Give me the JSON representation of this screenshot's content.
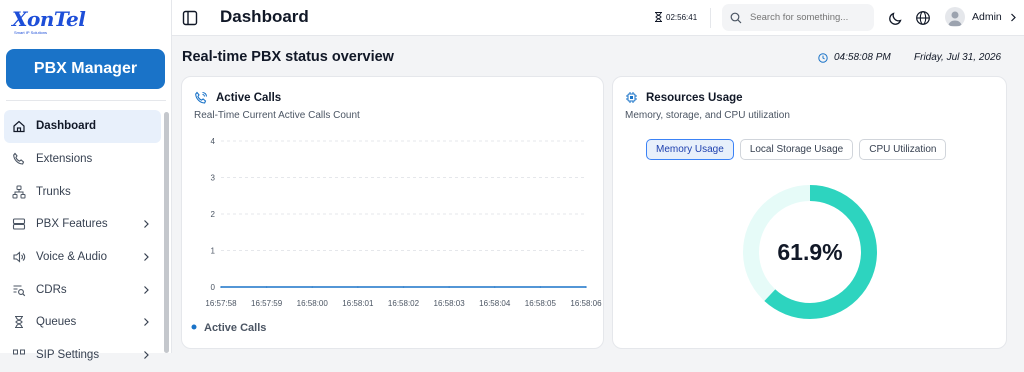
{
  "brand": {
    "logo_text": "XonTel",
    "tagline": "Smart IP Solutions"
  },
  "sidebar": {
    "pbx_button": "PBX Manager",
    "items": [
      {
        "label": "Dashboard",
        "icon": "home-icon",
        "active": true,
        "chevron": false
      },
      {
        "label": "Extensions",
        "icon": "phone-icon",
        "active": false,
        "chevron": false
      },
      {
        "label": "Trunks",
        "icon": "network-icon",
        "active": false,
        "chevron": false
      },
      {
        "label": "PBX Features",
        "icon": "server-icon",
        "active": false,
        "chevron": true
      },
      {
        "label": "Voice & Audio",
        "icon": "speaker-icon",
        "active": false,
        "chevron": true
      },
      {
        "label": "CDRs",
        "icon": "list-search-icon",
        "active": false,
        "chevron": true
      },
      {
        "label": "Queues",
        "icon": "hourglass-icon",
        "active": false,
        "chevron": true
      },
      {
        "label": "SIP Settings",
        "icon": "sip-icon",
        "active": false,
        "chevron": true
      }
    ]
  },
  "topbar": {
    "title": "Dashboard",
    "timer": "02:56:41",
    "search_placeholder": "Search for something...",
    "user": "Admin"
  },
  "content": {
    "page_title": "Real-time PBX status overview",
    "time": "04:58:08 PM",
    "date": "Friday, Jul 31, 2026"
  },
  "active_calls": {
    "title": "Active Calls",
    "subtitle": "Real-Time Current Active Calls Count",
    "legend": "Active Calls"
  },
  "resources": {
    "title": "Resources Usage",
    "subtitle": "Memory, storage, and CPU utilization",
    "tabs": [
      "Memory Usage",
      "Local Storage Usage",
      "CPU Utilization"
    ],
    "active_tab": 0,
    "percent_label": "61.9%"
  },
  "colors": {
    "accent": "#1a73c8",
    "line": "#1a73c8",
    "donut": "#2dd4bf",
    "donut_track": "#e6fbf8"
  },
  "chart_data": [
    {
      "type": "line",
      "title": "Active Calls",
      "x": [
        "16:57:58",
        "16:57:59",
        "16:58:00",
        "16:58:01",
        "16:58:02",
        "16:58:03",
        "16:58:04",
        "16:58:05",
        "16:58:06"
      ],
      "series": [
        {
          "name": "Active Calls",
          "values": [
            0,
            0,
            0,
            0,
            0,
            0,
            0,
            0,
            0
          ]
        }
      ],
      "yticks": [
        0,
        1,
        2,
        3,
        4
      ],
      "ylim": [
        0,
        4
      ],
      "grid": true,
      "legend": "bottom-left"
    },
    {
      "type": "pie",
      "title": "Memory Usage",
      "values": [
        61.9,
        38.1
      ]
    }
  ]
}
